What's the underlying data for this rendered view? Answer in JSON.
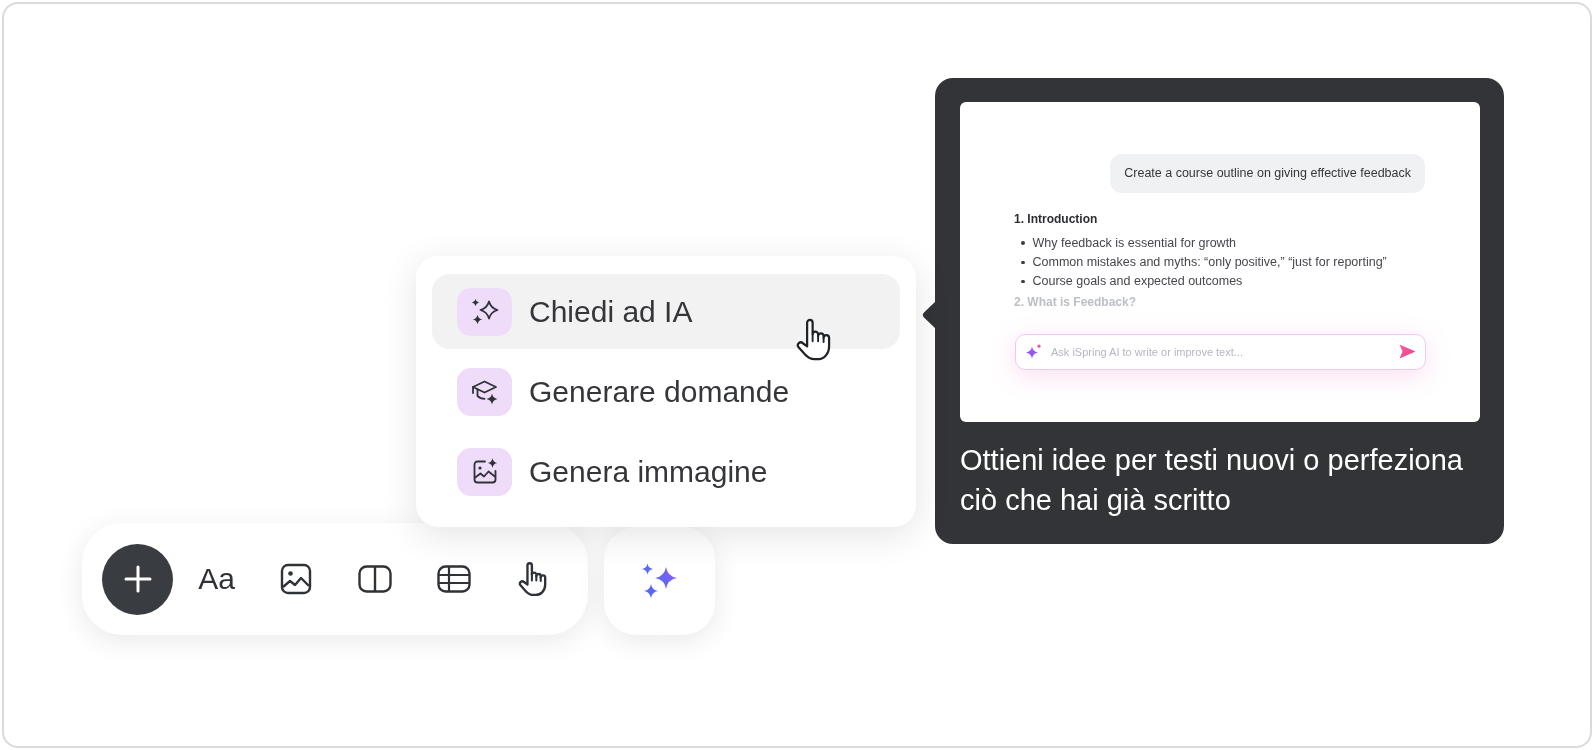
{
  "toolbar": {
    "items": [
      {
        "kind": "add"
      },
      {
        "kind": "text",
        "label": "Aa"
      },
      {
        "kind": "image"
      },
      {
        "kind": "columns"
      },
      {
        "kind": "table"
      },
      {
        "kind": "interaction"
      }
    ]
  },
  "ai_menu": {
    "items": [
      {
        "kind": "ask",
        "label": "Chiedi ad IA",
        "selected": true
      },
      {
        "kind": "questions",
        "label": "Generare domande",
        "selected": false
      },
      {
        "kind": "image",
        "label": "Genera immagine",
        "selected": false
      }
    ]
  },
  "tooltip": {
    "preview": {
      "user_message": "Create a course outline on giving effective feedback",
      "outline": [
        {
          "heading": "1. Introduction",
          "faded": false,
          "points": [
            "Why feedback is essential for growth",
            "Common mistakes and myths: “only positive,” “just for reporting”",
            "Course goals and expected outcomes"
          ]
        },
        {
          "heading": "2. What is Feedback?",
          "faded": true
        }
      ],
      "prompt": {
        "placeholder": "Ask iSpring AI to write or improve text..."
      }
    },
    "caption": "Ottieni idee per testi nuovi o perfeziona ciò che hai già scritto"
  }
}
